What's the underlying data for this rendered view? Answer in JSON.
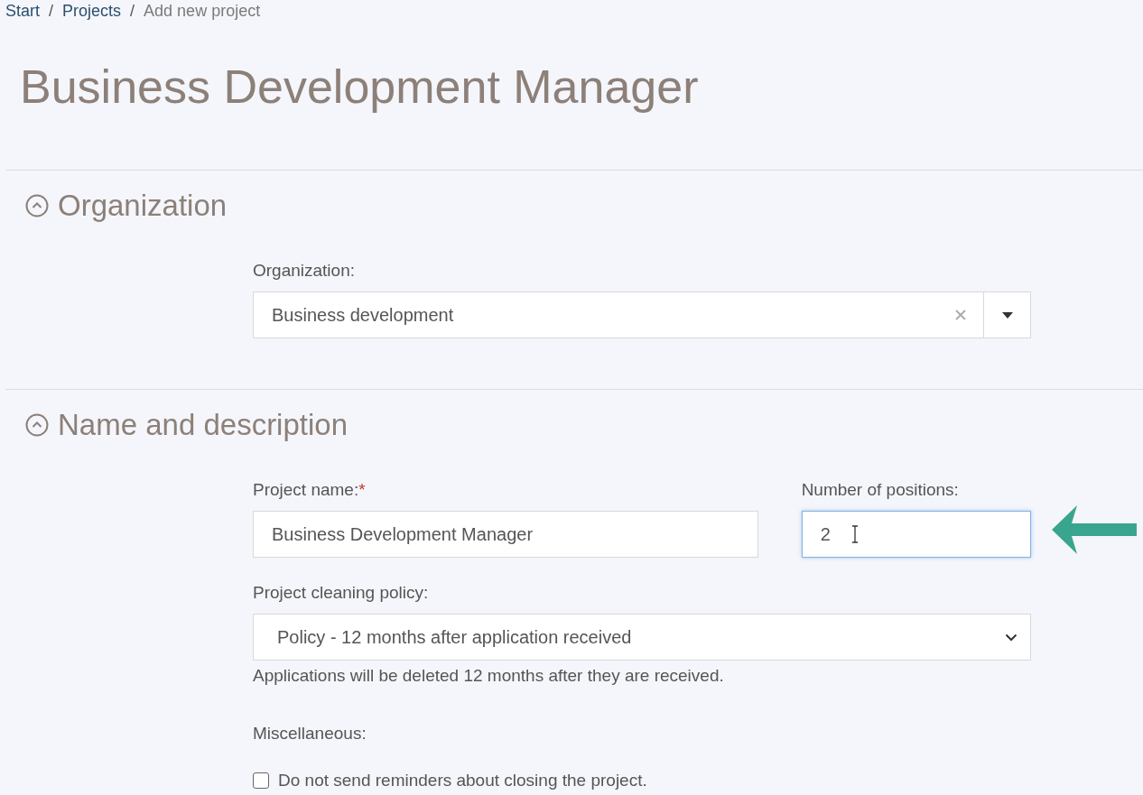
{
  "breadcrumb": {
    "items": [
      {
        "label": "Start",
        "link": true
      },
      {
        "label": "Projects",
        "link": true
      },
      {
        "label": "Add new project",
        "link": false
      }
    ],
    "separators": [
      "/",
      "/"
    ]
  },
  "title": "Business Development Manager",
  "sections": [
    {
      "title": "Organization",
      "expanded": true,
      "fields": [
        {
          "kind": "combobox",
          "label": "Organization:",
          "value": "Business development"
        }
      ]
    },
    {
      "title": "Name and description",
      "expanded": true,
      "fields": [
        {
          "kind": "row",
          "fields": [
            {
              "kind": "text",
              "label": "Project name:",
              "required_mark": "*",
              "value": "Business Development Manager",
              "focused": false
            },
            {
              "kind": "text",
              "label": "Number of positions:",
              "value": "2",
              "focused": true
            }
          ]
        },
        {
          "kind": "select",
          "label": "Project cleaning policy:",
          "value": "Policy - 12 months after application received",
          "help": "Applications will be deleted 12 months after they are received."
        },
        {
          "kind": "checkboxes",
          "label": "Miscellaneous:",
          "options": [
            {
              "label": "Do not send reminders about closing the project.",
              "checked": false
            }
          ]
        }
      ]
    }
  ]
}
